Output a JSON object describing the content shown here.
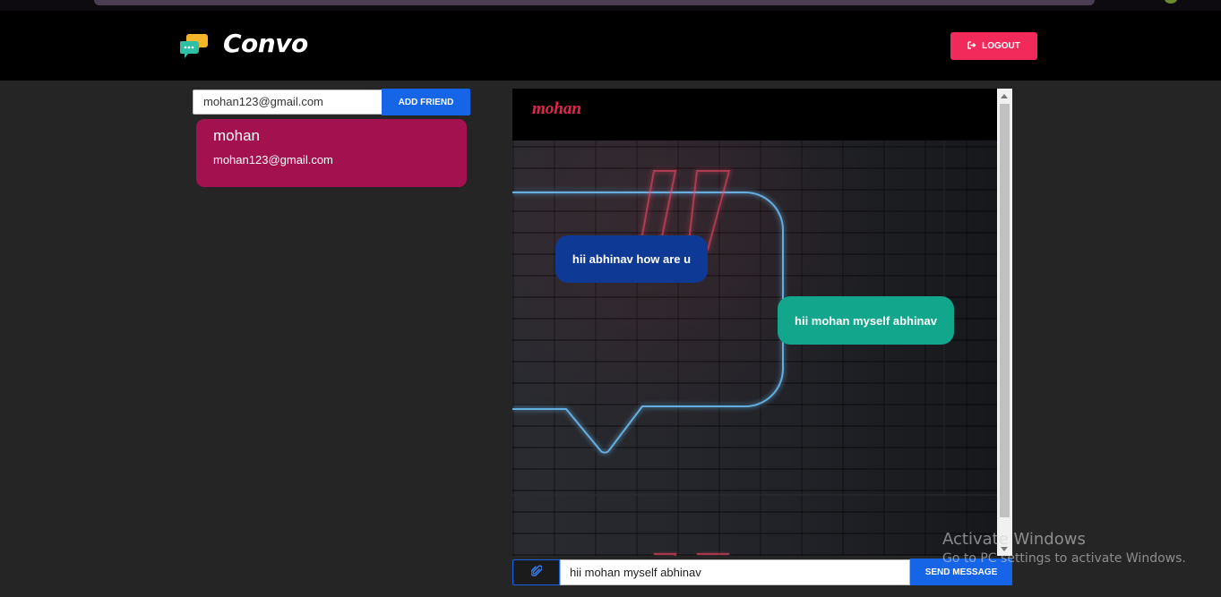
{
  "app": {
    "name": "Convo",
    "logout_label": "LOGOUT"
  },
  "friends": {
    "search_value": "mohan123@gmail.com",
    "add_button_label": "ADD FRIEND",
    "items": [
      {
        "name": "mohan",
        "email": "mohan123@gmail.com"
      }
    ]
  },
  "chat": {
    "title": "mohan",
    "messages": [
      {
        "text": "hii abhinav how are u",
        "side": "left"
      },
      {
        "text": "hii mohan myself abhinav",
        "side": "right"
      }
    ],
    "input_value": "hii mohan myself abhinav",
    "send_label": "SEND MESSAGE"
  },
  "watermark": {
    "title": "Activate Windows",
    "subtitle": "Go to PC settings to activate Windows."
  },
  "icons": {
    "logo": "chat-bubbles-icon",
    "logout": "sign-out-icon",
    "attach": "paperclip-icon"
  },
  "colors": {
    "header_bg": "#000000",
    "page_bg": "#252525",
    "accent_red": "#f2295b",
    "accent_blue": "#1565e6",
    "friend_card": "#a3124f",
    "bubble_left": "#0e3a96",
    "bubble_right": "#12a68c"
  }
}
